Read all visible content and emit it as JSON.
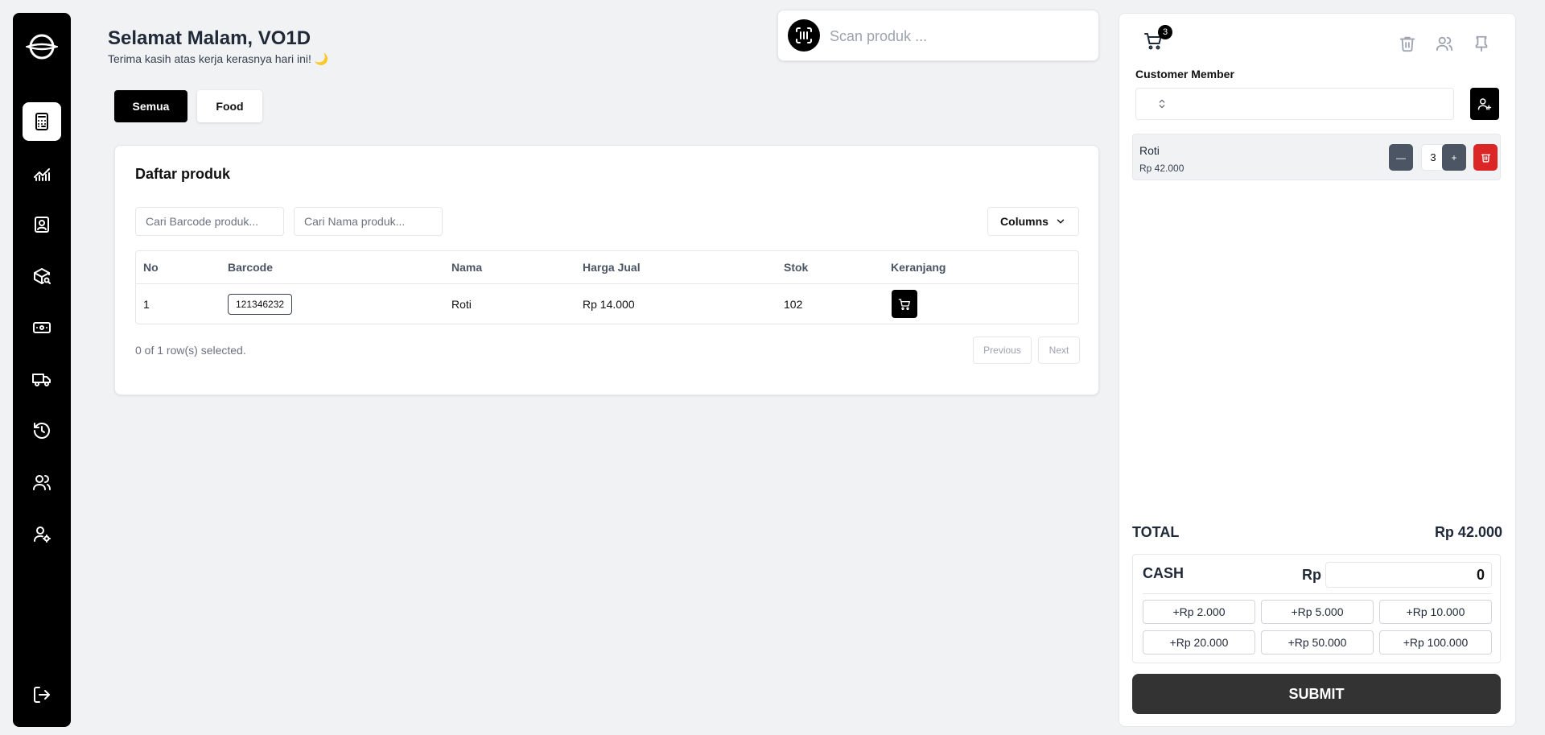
{
  "header": {
    "greeting": "Selamat Malam, VO1D",
    "subgreeting": "Terima kasih atas kerja kerasnya hari ini! 🌙"
  },
  "categories": [
    {
      "label": "Semua",
      "active": true
    },
    {
      "label": "Food",
      "active": false
    }
  ],
  "scan": {
    "placeholder": "Scan produk ..."
  },
  "products": {
    "title": "Daftar produk",
    "search_barcode_placeholder": "Cari Barcode produk...",
    "search_name_placeholder": "Cari Nama produk...",
    "columns_label": "Columns",
    "headers": [
      "No",
      "Barcode",
      "Nama",
      "Harga Jual",
      "Stok",
      "Keranjang"
    ],
    "rows": [
      {
        "no": "1",
        "barcode": "121346232",
        "nama": "Roti",
        "harga": "Rp 14.000",
        "stok": "102"
      }
    ],
    "selected_text": "0 of 1 row(s) selected.",
    "previous_label": "Previous",
    "next_label": "Next"
  },
  "cart": {
    "count": "3",
    "member_label": "Customer Member",
    "items": [
      {
        "name": "Roti",
        "price": "Rp 42.000",
        "qty": "3",
        "minus": "—",
        "plus": "+"
      }
    ],
    "total_label": "TOTAL",
    "total_value": "Rp 42.000",
    "cash_label": "CASH",
    "currency": "Rp",
    "cash_value": "0",
    "quick_amounts": [
      "+Rp 2.000",
      "+Rp 5.000",
      "+Rp 10.000",
      "+Rp 20.000",
      "+Rp 50.000",
      "+Rp 100.000"
    ],
    "submit_label": "SUBMIT"
  },
  "colors": {
    "accent": "#000000",
    "danger": "#dc2626",
    "qty_button": "#4b5563",
    "submit": "#333333"
  },
  "icons": {
    "sidebar": [
      "calculator-icon",
      "chart-icon",
      "contact-icon",
      "package-search-icon",
      "banknote-icon",
      "truck-icon",
      "history-icon",
      "users-icon",
      "user-cog-icon",
      "logout-icon"
    ],
    "panel": [
      "trash-icon",
      "user-icon",
      "pin-icon"
    ]
  }
}
